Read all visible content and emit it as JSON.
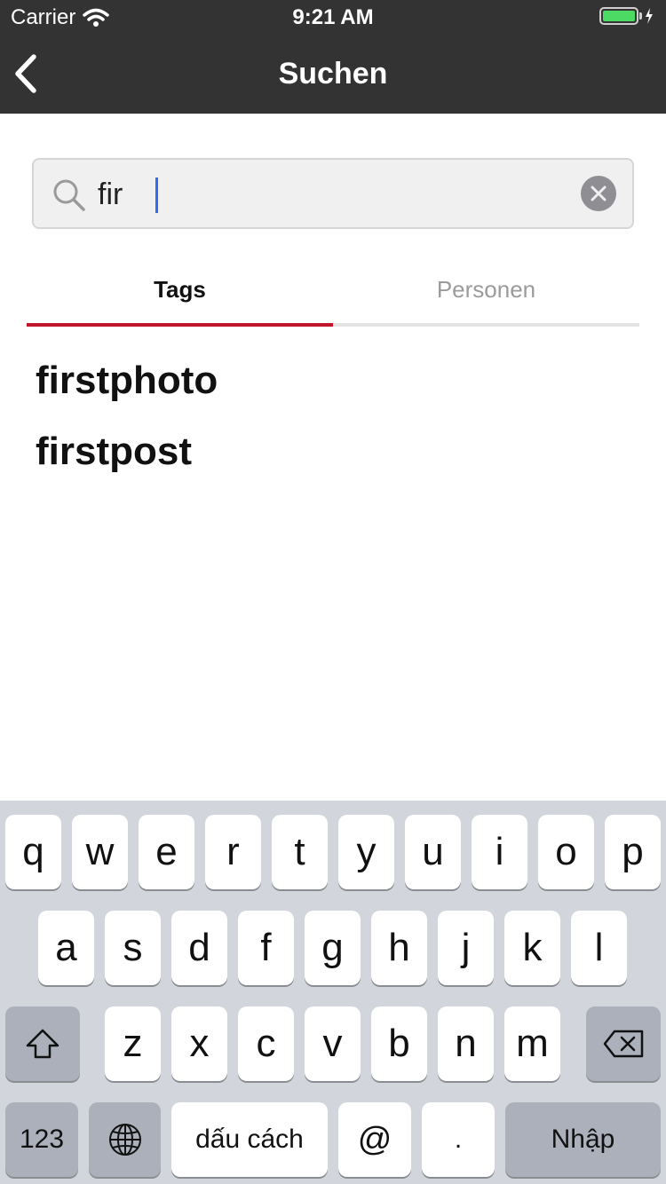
{
  "status_bar": {
    "carrier": "Carrier",
    "time": "9:21 AM"
  },
  "nav": {
    "title": "Suchen",
    "back_icon": "chevron-left-icon"
  },
  "search": {
    "value": "fir",
    "placeholder": ""
  },
  "tabs": [
    {
      "label": "Tags",
      "active": true
    },
    {
      "label": "Personen",
      "active": false
    }
  ],
  "results": [
    "firstphoto",
    "firstpost"
  ],
  "keyboard": {
    "row1": [
      "q",
      "w",
      "e",
      "r",
      "t",
      "y",
      "u",
      "i",
      "o",
      "p"
    ],
    "row2": [
      "a",
      "s",
      "d",
      "f",
      "g",
      "h",
      "j",
      "k",
      "l"
    ],
    "row3": [
      "z",
      "x",
      "c",
      "v",
      "b",
      "n",
      "m"
    ],
    "numbers_label": "123",
    "space_label": "dấu cách",
    "at_label": "@",
    "dot_label": ".",
    "return_label": "Nhập"
  },
  "colors": {
    "bar_background": "#333333",
    "tab_active_underline": "#c0162b",
    "battery": "#4cd964",
    "keyboard_background": "#d2d5db"
  }
}
